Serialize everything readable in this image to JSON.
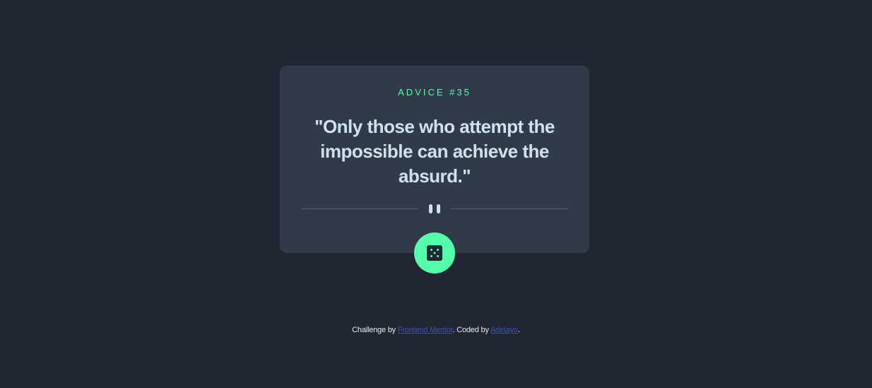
{
  "card": {
    "advice_label": "ADVICE #35",
    "quote": "\"Only those who attempt the impossible can achieve the absurd.\""
  },
  "divider": {
    "icon": "pause-icon"
  },
  "dice_button": {
    "icon": "dice-icon"
  },
  "footer": {
    "prefix": "Challenge by ",
    "link1": "Frontend Mentor",
    "middle": ". Coded by ",
    "link2": "Adetayo",
    "suffix": "."
  },
  "colors": {
    "background": "#202733",
    "card": "#313a48",
    "accent": "#53ffaa",
    "quote_text": "#cee3e9",
    "link": "#3e52a3"
  }
}
